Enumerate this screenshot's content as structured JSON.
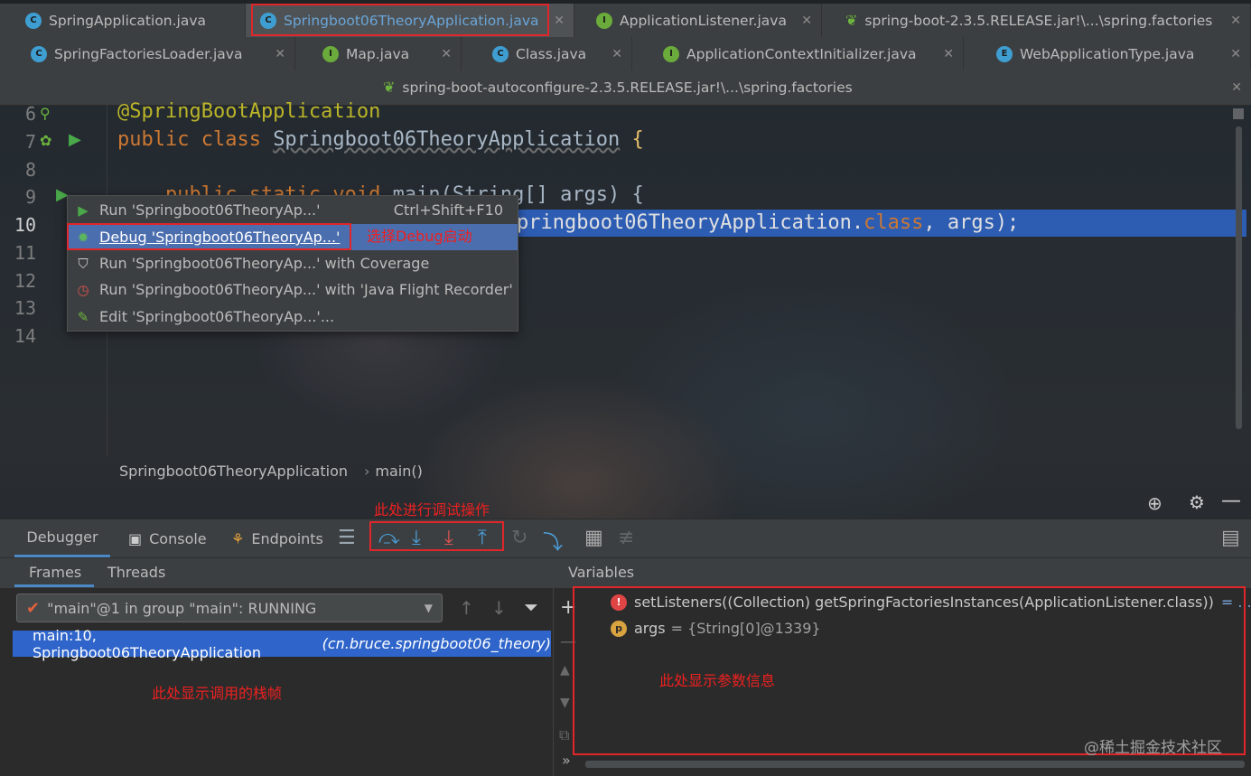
{
  "tabs_row1": [
    {
      "label": "SpringApplication.java",
      "icon": "C"
    },
    {
      "label": "Springboot06TheoryApplication.java",
      "icon": "C"
    },
    {
      "label": "ApplicationListener.java",
      "icon": "I"
    },
    {
      "label": "spring-boot-2.3.5.RELEASE.jar!\\...\\spring.factories",
      "icon": "leaf"
    }
  ],
  "tabs_row2": [
    {
      "label": "SpringFactoriesLoader.java",
      "icon": "C"
    },
    {
      "label": "Map.java",
      "icon": "I"
    },
    {
      "label": "Class.java",
      "icon": "C"
    },
    {
      "label": "ApplicationContextInitializer.java",
      "icon": "I"
    },
    {
      "label": "WebApplicationType.java",
      "icon": "E"
    }
  ],
  "tabs_row3": [
    {
      "label": "spring-boot-autoconfigure-2.3.5.RELEASE.jar!\\...\\spring.factories",
      "icon": "leaf"
    }
  ],
  "editor": {
    "line_numbers": [
      "6",
      "7",
      "8",
      "9",
      "10",
      "11",
      "12",
      "13",
      "14"
    ],
    "line6": "@SpringBootApplication",
    "line7_kw": "public class ",
    "line7_cls": "Springboot06TheoryApplication",
    "line7_brace": " {",
    "line9_kw": "    public static void ",
    "line9_rest": "main(String[] args) {",
    "line10_rest": "pringboot06TheoryApplication.",
    "line10_kw": "class",
    "line10_end": ", args);"
  },
  "breadcrumb": {
    "class": "Springboot06TheoryApplication",
    "method": "main()"
  },
  "context_menu": [
    {
      "label": "Run 'Springboot06TheoryAp...'",
      "shortcut": "Ctrl+Shift+F10",
      "icon": "run-icon"
    },
    {
      "label": "Debug 'Springboot06TheoryAp...'",
      "shortcut": "",
      "icon": "debug-icon"
    },
    {
      "label": "Run 'Springboot06TheoryAp...' with Coverage",
      "shortcut": "",
      "icon": "coverage-icon"
    },
    {
      "label": "Run 'Springboot06TheoryAp...' with 'Java Flight Recorder'",
      "shortcut": "",
      "icon": "flight-recorder-icon"
    },
    {
      "label": "Edit 'Springboot06TheoryAp...'...",
      "shortcut": "",
      "icon": "edit-config-icon"
    }
  ],
  "annotations": {
    "debug_start": "选择Debug启动",
    "debug_ops": "此处进行调试操作",
    "frames_info": "此处显示调用的栈帧",
    "vars_info": "此处显示参数信息"
  },
  "debug_panel": {
    "tabs": [
      "Debugger",
      "Console",
      "Endpoints"
    ],
    "subtabs": [
      "Frames",
      "Threads"
    ],
    "variables_label": "Variables",
    "thread_selector": "\"main\"@1 in group \"main\": RUNNING",
    "frame": {
      "main": "main:10, Springboot06TheoryApplication",
      "pkg": "(cn.bruce.springboot06_theory)"
    },
    "variables": [
      {
        "badge": "!",
        "name": "setListeners((Collection) getSpringFactoriesInstances(ApplicationListener.class))",
        "value": "= ... View"
      },
      {
        "badge": "p",
        "name": "args",
        "value": "= {String[0]@1339}"
      }
    ]
  },
  "watermark": "@稀土掘金技术社区",
  "colors": {
    "accent": "#2f65ca",
    "annotation_red": "#e0262a",
    "keyword": "#cc7832",
    "annotation": "#bbb529"
  }
}
